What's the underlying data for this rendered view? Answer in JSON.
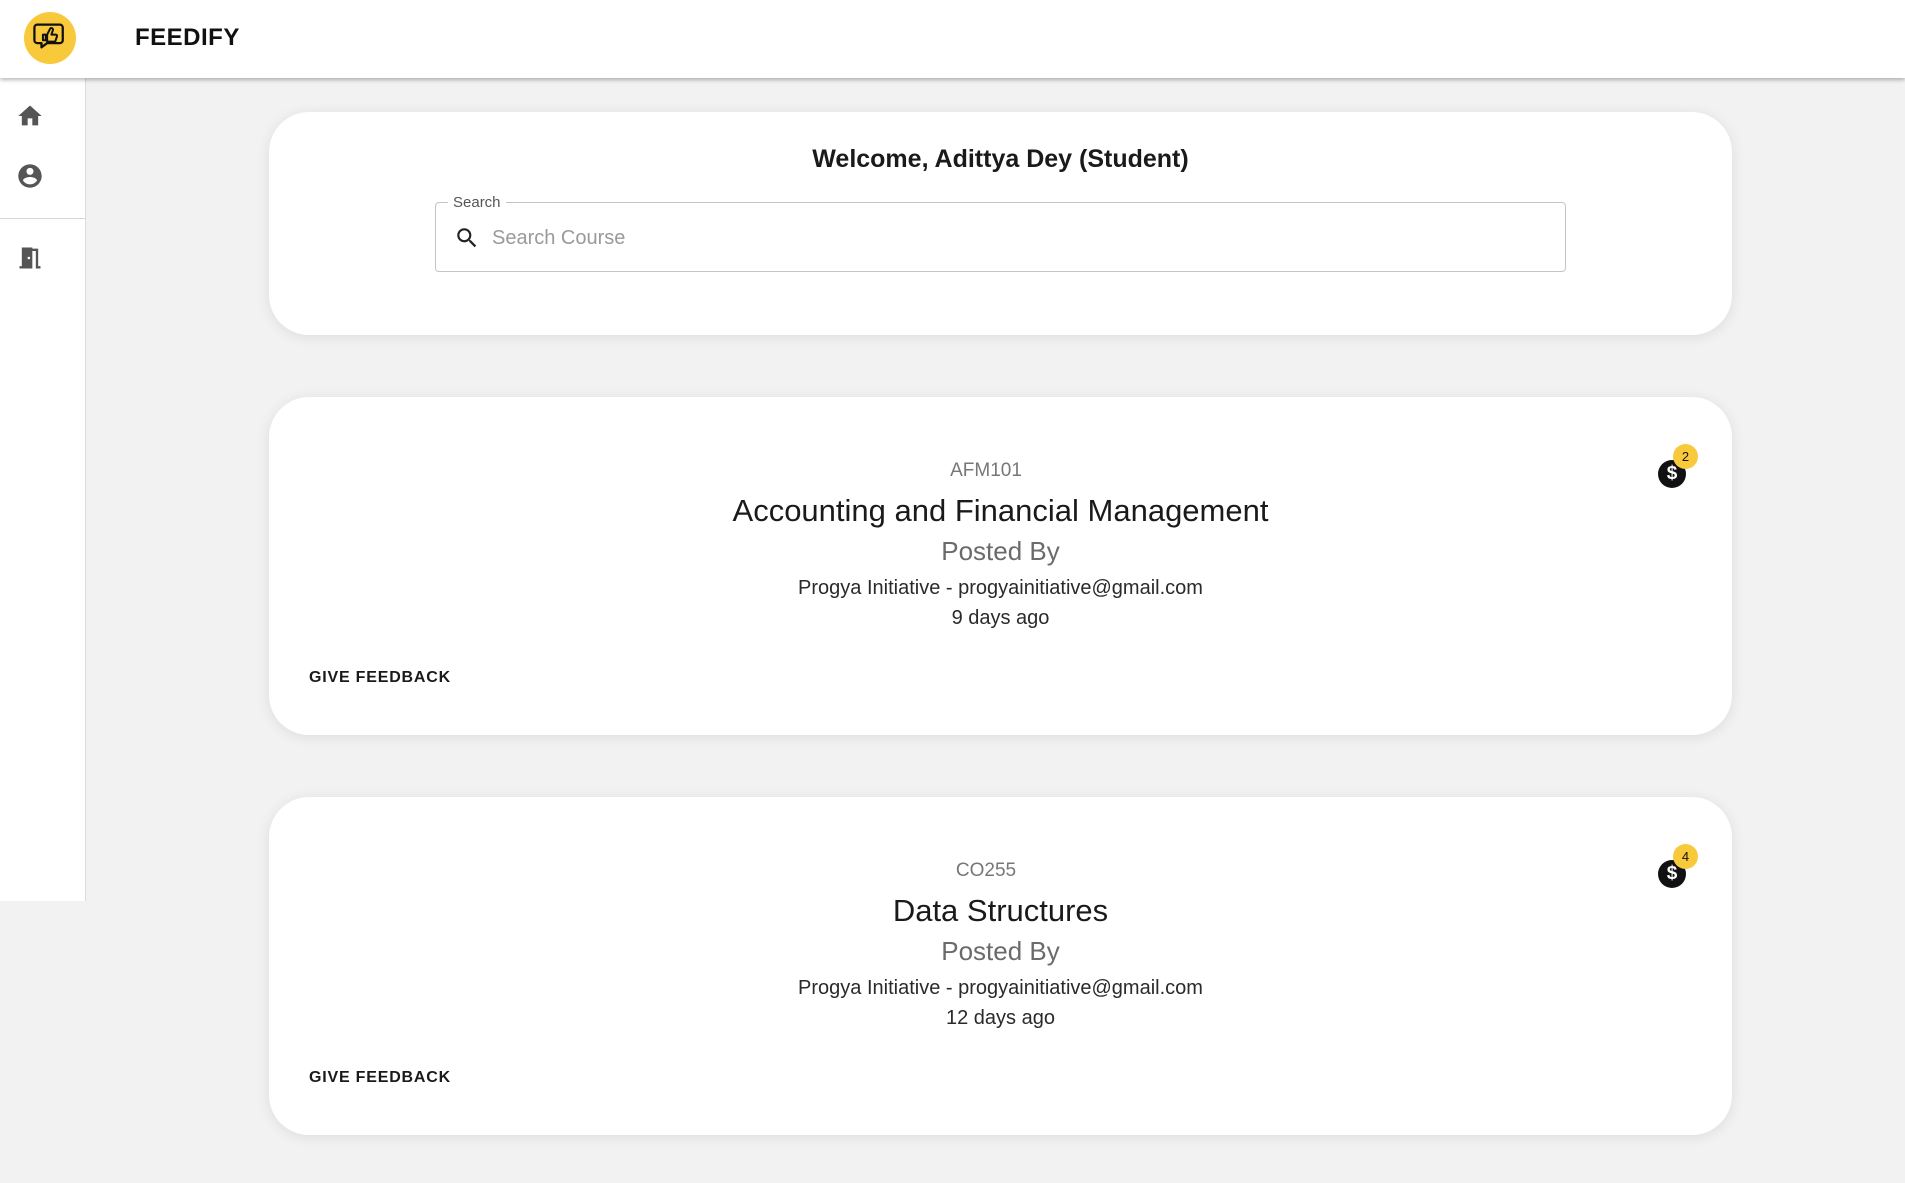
{
  "app": {
    "name": "FEEDIFY",
    "accent_color": "#f8c93a",
    "logo_icon": "thumbs-up-chat-icon"
  },
  "sidebar": {
    "items": [
      {
        "name": "home",
        "icon": "home-icon"
      },
      {
        "name": "profile",
        "icon": "account-circle-icon"
      },
      {
        "name": "logout",
        "icon": "exit-door-icon"
      }
    ]
  },
  "welcome": {
    "title": "Welcome, Adittya Dey (Student)",
    "search_label": "Search",
    "search_placeholder": "Search Course",
    "search_value": ""
  },
  "courses": [
    {
      "code": "AFM101",
      "title": "Accounting and Financial Management",
      "posted_by_label": "Posted By",
      "poster": "Progya Initiative - progyainitiative@gmail.com",
      "time": "9 days ago",
      "action_label": "GIVE FEEDBACK",
      "coin_icon": "dollar-coin-icon",
      "coin_symbol": "$",
      "badge": "2"
    },
    {
      "code": "CO255",
      "title": "Data Structures",
      "posted_by_label": "Posted By",
      "poster": "Progya Initiative - progyainitiative@gmail.com",
      "time": "12 days ago",
      "action_label": "GIVE FEEDBACK",
      "coin_icon": "dollar-coin-icon",
      "coin_symbol": "$",
      "badge": "4"
    }
  ]
}
